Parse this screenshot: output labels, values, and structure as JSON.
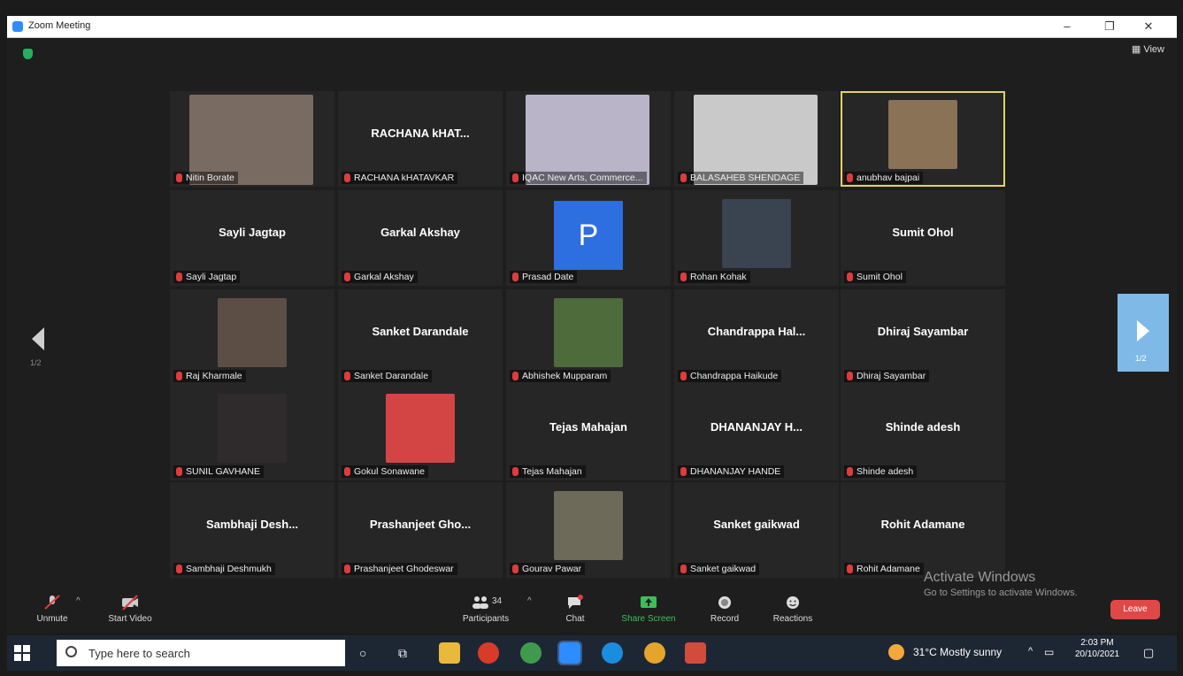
{
  "window": {
    "title": "Zoom Meeting",
    "view_label": "View",
    "minimize": "–",
    "restore": "❐",
    "close": "✕"
  },
  "participants": [
    {
      "id": "nitin",
      "name": "Nitin Borate",
      "display": "",
      "kind": "video",
      "color": "#7a6b62",
      "pos": [
        0,
        0
      ]
    },
    {
      "id": "rachana",
      "name": "RACHANA kHATAVKAR",
      "display": "RACHANA kHAT...",
      "kind": "name",
      "pos": [
        1,
        0
      ]
    },
    {
      "id": "iqac",
      "name": "IQAC New Arts, Commerce...",
      "display": "",
      "kind": "video",
      "color": "#b9b4c8",
      "pos": [
        2,
        0
      ]
    },
    {
      "id": "balasaheb",
      "name": "BALASAHEB SHENDAGE",
      "display": "",
      "kind": "video",
      "color": "#c9c9c9",
      "pos": [
        3,
        0
      ]
    },
    {
      "id": "anubhav",
      "name": "anubhav bajpai",
      "display": "",
      "kind": "thumb",
      "color": "#8a7256",
      "pos": [
        4,
        0
      ],
      "active": true
    },
    {
      "id": "sayli",
      "name": "Sayli Jagtap",
      "display": "Sayli Jagtap",
      "kind": "name",
      "pos": [
        0,
        1
      ]
    },
    {
      "id": "garkal",
      "name": "Garkal Akshay",
      "display": "Garkal Akshay",
      "kind": "name",
      "pos": [
        1,
        1
      ]
    },
    {
      "id": "prasad",
      "name": "Prasad Date",
      "display": "P",
      "kind": "avatar",
      "pos": [
        2,
        1
      ]
    },
    {
      "id": "rohan",
      "name": "Rohan Kohak",
      "display": "",
      "kind": "thumb",
      "color": "#3a4350",
      "pos": [
        3,
        1
      ]
    },
    {
      "id": "sumit",
      "name": "Sumit Ohol",
      "display": "Sumit Ohol",
      "kind": "name",
      "pos": [
        4,
        1
      ]
    },
    {
      "id": "raj",
      "name": "Raj Kharmale",
      "display": "",
      "kind": "thumb",
      "color": "#5c4e45",
      "pos": [
        0,
        2
      ]
    },
    {
      "id": "sanketd",
      "name": "Sanket Darandale",
      "display": "Sanket Darandale",
      "kind": "name",
      "pos": [
        1,
        2
      ]
    },
    {
      "id": "abhishek",
      "name": "Abhishek Mupparam",
      "display": "",
      "kind": "thumb",
      "color": "#4d6b3b",
      "pos": [
        2,
        2
      ]
    },
    {
      "id": "chandrappa",
      "name": "Chandrappa Haikude",
      "display": "Chandrappa  Hal...",
      "kind": "name",
      "pos": [
        3,
        2
      ]
    },
    {
      "id": "dhiraj",
      "name": "Dhiraj Sayambar",
      "display": "Dhiraj Sayambar",
      "kind": "name",
      "pos": [
        4,
        2
      ]
    },
    {
      "id": "sunil",
      "name": "SUNIL GAVHANE",
      "display": "",
      "kind": "thumb",
      "color": "#2f2b2c",
      "pos": [
        0,
        3
      ]
    },
    {
      "id": "gokul",
      "name": "Gokul Sonawane",
      "display": "",
      "kind": "thumb",
      "color": "#d34545",
      "pos": [
        1,
        3
      ]
    },
    {
      "id": "tejas",
      "name": "Tejas Mahajan",
      "display": "Tejas Mahajan",
      "kind": "name",
      "pos": [
        2,
        3
      ]
    },
    {
      "id": "dhananjay",
      "name": "DHANANJAY HANDE",
      "display": "DHANANJAY H...",
      "kind": "name",
      "pos": [
        3,
        3
      ]
    },
    {
      "id": "shinde",
      "name": "Shinde adesh",
      "display": "Shinde adesh",
      "kind": "name",
      "pos": [
        4,
        3
      ]
    },
    {
      "id": "sambhaji",
      "name": "Sambhaji Deshmukh",
      "display": "Sambhaji  Desh...",
      "kind": "name",
      "pos": [
        0,
        4
      ]
    },
    {
      "id": "prashanjeet",
      "name": "Prashanjeet Ghodeswar",
      "display": "Prashanjeet  Gho...",
      "kind": "name",
      "pos": [
        1,
        4
      ]
    },
    {
      "id": "gourav",
      "name": "Gourav Pawar",
      "display": "",
      "kind": "thumb",
      "color": "#6d6a5a",
      "pos": [
        2,
        4
      ]
    },
    {
      "id": "sanketg",
      "name": "Sanket gaikwad",
      "display": "Sanket gaikwad",
      "kind": "name",
      "pos": [
        3,
        4
      ]
    },
    {
      "id": "rohit",
      "name": "Rohit Adamane",
      "display": "Rohit Adamane",
      "kind": "name",
      "pos": [
        4,
        4
      ]
    }
  ],
  "pager": {
    "left": "1/2",
    "right": "1/2"
  },
  "toolbar": {
    "unmute": "Unmute",
    "start_video": "Start Video",
    "participants": "Participants",
    "participants_count": "34",
    "chat": "Chat",
    "share_screen": "Share Screen",
    "record": "Record",
    "reactions": "Reactions",
    "leave": "Leave"
  },
  "watermark": {
    "line1": "Activate Windows",
    "line2": "Go to Settings to activate Windows."
  },
  "taskbar": {
    "search_placeholder": "Type here to search",
    "weather": "31°C  Mostly sunny",
    "time": "2:03 PM",
    "date": "20/10/2021"
  },
  "colors": {
    "accent": "#2d8cff",
    "active_border": "#e3d266",
    "leave": "#e04848",
    "share": "#3cbf5a"
  }
}
